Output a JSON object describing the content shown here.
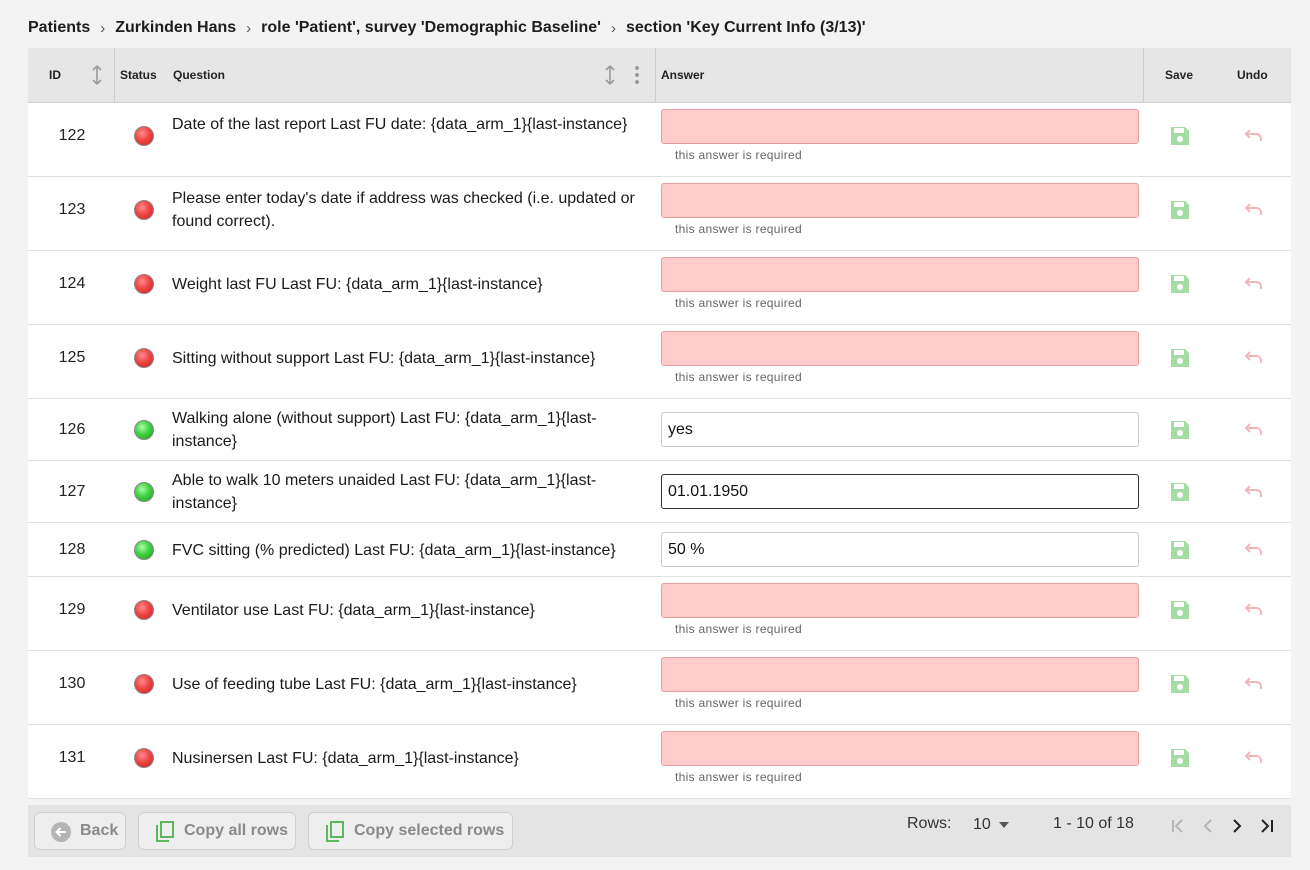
{
  "breadcrumb": {
    "items": [
      "Patients",
      "Zurkinden Hans",
      "role 'Patient', survey 'Demographic Baseline'",
      "section 'Key Current Info (3/13)'"
    ],
    "separator": "›"
  },
  "table": {
    "headers": {
      "id": "ID",
      "status": "Status",
      "question": "Question",
      "answer": "Answer",
      "save": "Save",
      "undo": "Undo"
    },
    "required_message": "this answer is required",
    "rows": [
      {
        "id": "122",
        "status": "red",
        "question": "Date of the last report Last FU date: {data_arm_1}{last-instance}",
        "answer": ""
      },
      {
        "id": "123",
        "status": "red",
        "question": "Please enter today's date if address was checked (i.e. updated or found correct).",
        "answer": ""
      },
      {
        "id": "124",
        "status": "red",
        "question": "Weight last FU Last FU: {data_arm_1}{last-instance}",
        "answer": ""
      },
      {
        "id": "125",
        "status": "red",
        "question": "Sitting without support Last FU: {data_arm_1}{last-instance}",
        "answer": ""
      },
      {
        "id": "126",
        "status": "green",
        "question": "Walking alone (without support) Last FU: {data_arm_1}{last-instance}",
        "answer": "yes"
      },
      {
        "id": "127",
        "status": "green",
        "question": "Able to walk 10 meters unaided Last FU: {data_arm_1}{last-instance}",
        "answer": "01.01.1950"
      },
      {
        "id": "128",
        "status": "green",
        "question": "FVC sitting (% predicted) Last FU: {data_arm_1}{last-instance}",
        "answer": "50 %"
      },
      {
        "id": "129",
        "status": "red",
        "question": "Ventilator use Last FU: {data_arm_1}{last-instance}",
        "answer": ""
      },
      {
        "id": "130",
        "status": "red",
        "question": "Use of feeding tube Last FU: {data_arm_1}{last-instance}",
        "answer": ""
      },
      {
        "id": "131",
        "status": "red",
        "question": "Nusinersen Last FU: {data_arm_1}{last-instance}",
        "answer": ""
      }
    ]
  },
  "footer": {
    "back_label": "Back",
    "copy_all_label": "Copy all rows",
    "copy_selected_label": "Copy selected rows",
    "rows_label": "Rows:",
    "rows_value": "10",
    "range_text": "1 - 10 of 18"
  },
  "colors": {
    "status_red": "#f04646",
    "status_green": "#43d143",
    "invalid_bg": "#ffcccc",
    "save_icon": "#a5dca5",
    "undo_icon": "#f2b6b6",
    "copy_icon": "#4caf50"
  },
  "icons": {
    "sort": "sort-arrows-icon",
    "more": "more-vertical-icon",
    "save": "floppy-disk-icon",
    "undo": "undo-arrow-icon",
    "back": "arrow-left-circle-icon",
    "copy": "copy-icon"
  }
}
